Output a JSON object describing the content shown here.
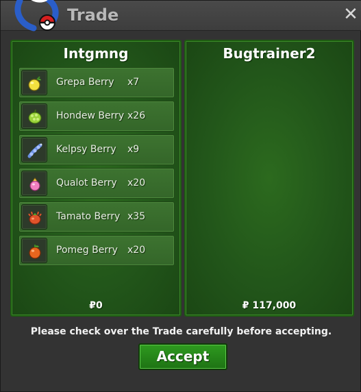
{
  "window": {
    "title": "Trade",
    "close_glyph": "✕"
  },
  "left_panel": {
    "player_name": "Intgmng",
    "items": [
      {
        "name": "Grepa Berry",
        "qty": "x7",
        "icon": "grepa-berry-icon"
      },
      {
        "name": "Hondew Berry",
        "qty": "x26",
        "icon": "hondew-berry-icon"
      },
      {
        "name": "Kelpsy Berry",
        "qty": "x9",
        "icon": "kelpsy-berry-icon"
      },
      {
        "name": "Qualot Berry",
        "qty": "x20",
        "icon": "qualot-berry-icon"
      },
      {
        "name": "Tamato Berry",
        "qty": "x35",
        "icon": "tamato-berry-icon"
      },
      {
        "name": "Pomeg Berry",
        "qty": "x20",
        "icon": "pomeg-berry-icon"
      }
    ],
    "money": "₽0"
  },
  "right_panel": {
    "player_name": "Bugtrainer2",
    "items": [],
    "money": "₽ 117,000"
  },
  "footer": {
    "notice": "Please check over the Trade carefully before accepting.",
    "accept_label": "Accept"
  },
  "colors": {
    "panel_green": "#22561a",
    "accept_green": "#2e9a1f",
    "window_bg": "#333333"
  }
}
